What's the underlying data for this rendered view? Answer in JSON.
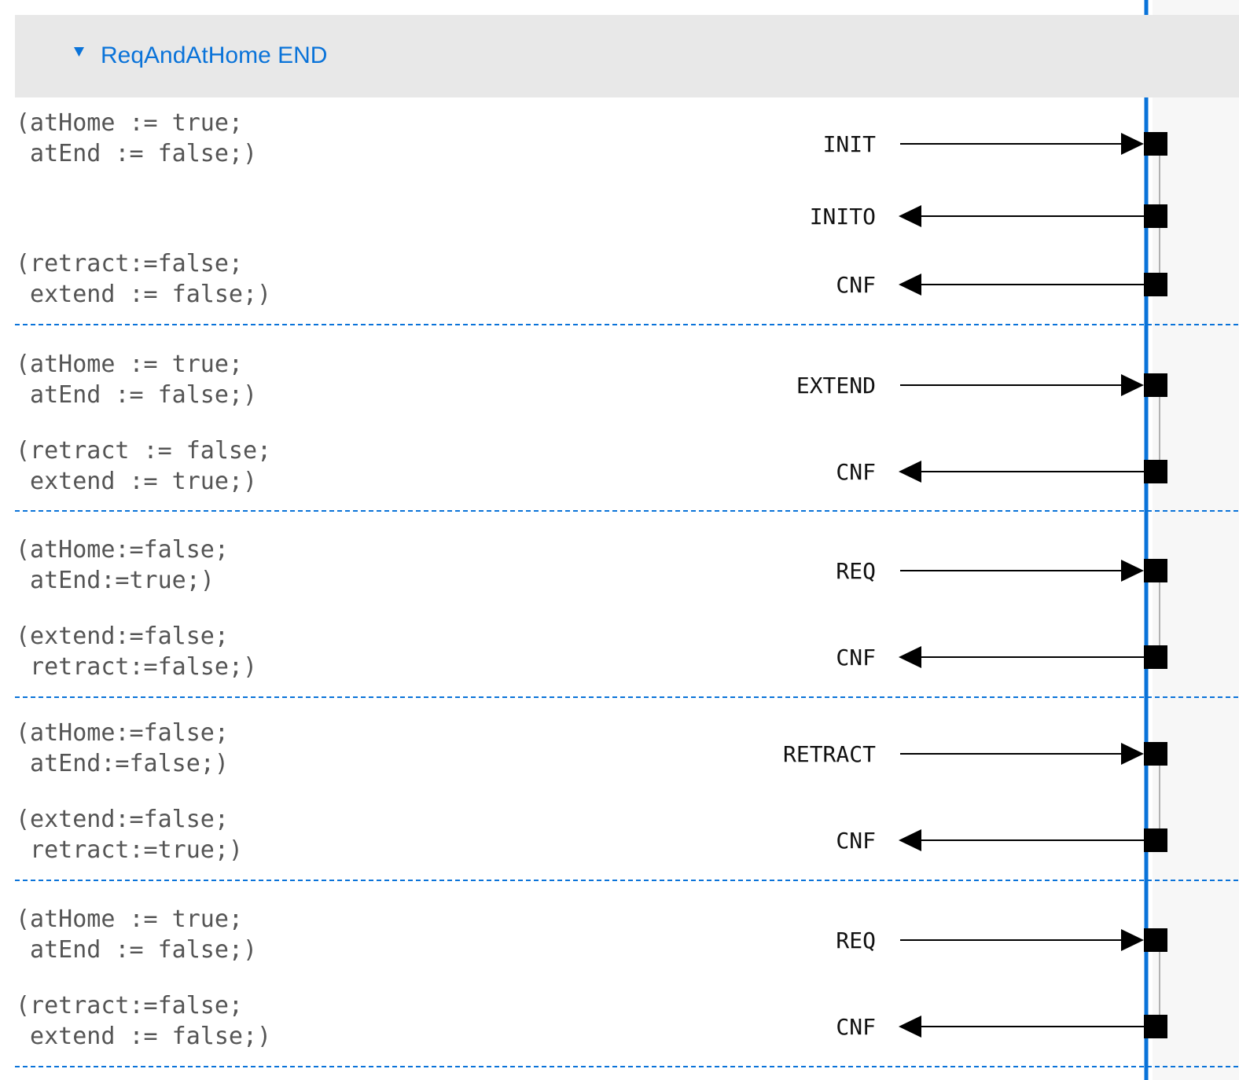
{
  "header": {
    "expand_icon": "triangle-down-icon",
    "title": "ReqAndAtHome END"
  },
  "colors": {
    "accent": "#0a73d9",
    "header_bg": "#e8e8e8",
    "right_panel_bg": "#f7f7f7",
    "code_text": "#555555",
    "event_text": "#111111"
  },
  "steps": [
    {
      "events": [
        {
          "label": "INIT",
          "direction": "in",
          "annotation": [
            "(atHome := true;",
            " atEnd := false;)"
          ]
        },
        {
          "label": "INITO",
          "direction": "out",
          "annotation": []
        },
        {
          "label": "CNF",
          "direction": "out",
          "annotation": [
            "(retract:=false;",
            " extend := false;)"
          ]
        }
      ]
    },
    {
      "events": [
        {
          "label": "EXTEND",
          "direction": "in",
          "annotation": [
            "(atHome := true;",
            " atEnd := false;)"
          ]
        },
        {
          "label": "CNF",
          "direction": "out",
          "annotation": [
            "(retract := false;",
            " extend := true;)"
          ]
        }
      ]
    },
    {
      "events": [
        {
          "label": "REQ",
          "direction": "in",
          "annotation": [
            "(atHome:=false;",
            " atEnd:=true;)"
          ]
        },
        {
          "label": "CNF",
          "direction": "out",
          "annotation": [
            "(extend:=false;",
            " retract:=false;)"
          ]
        }
      ]
    },
    {
      "events": [
        {
          "label": "RETRACT",
          "direction": "in",
          "annotation": [
            "(atHome:=false;",
            " atEnd:=false;)"
          ]
        },
        {
          "label": "CNF",
          "direction": "out",
          "annotation": [
            "(extend:=false;",
            " retract:=true;)"
          ]
        }
      ]
    },
    {
      "events": [
        {
          "label": "REQ",
          "direction": "in",
          "annotation": [
            "(atHome := true;",
            " atEnd := false;)"
          ]
        },
        {
          "label": "CNF",
          "direction": "out",
          "annotation": [
            "(retract:=false;",
            " extend := false;)"
          ]
        }
      ]
    }
  ]
}
